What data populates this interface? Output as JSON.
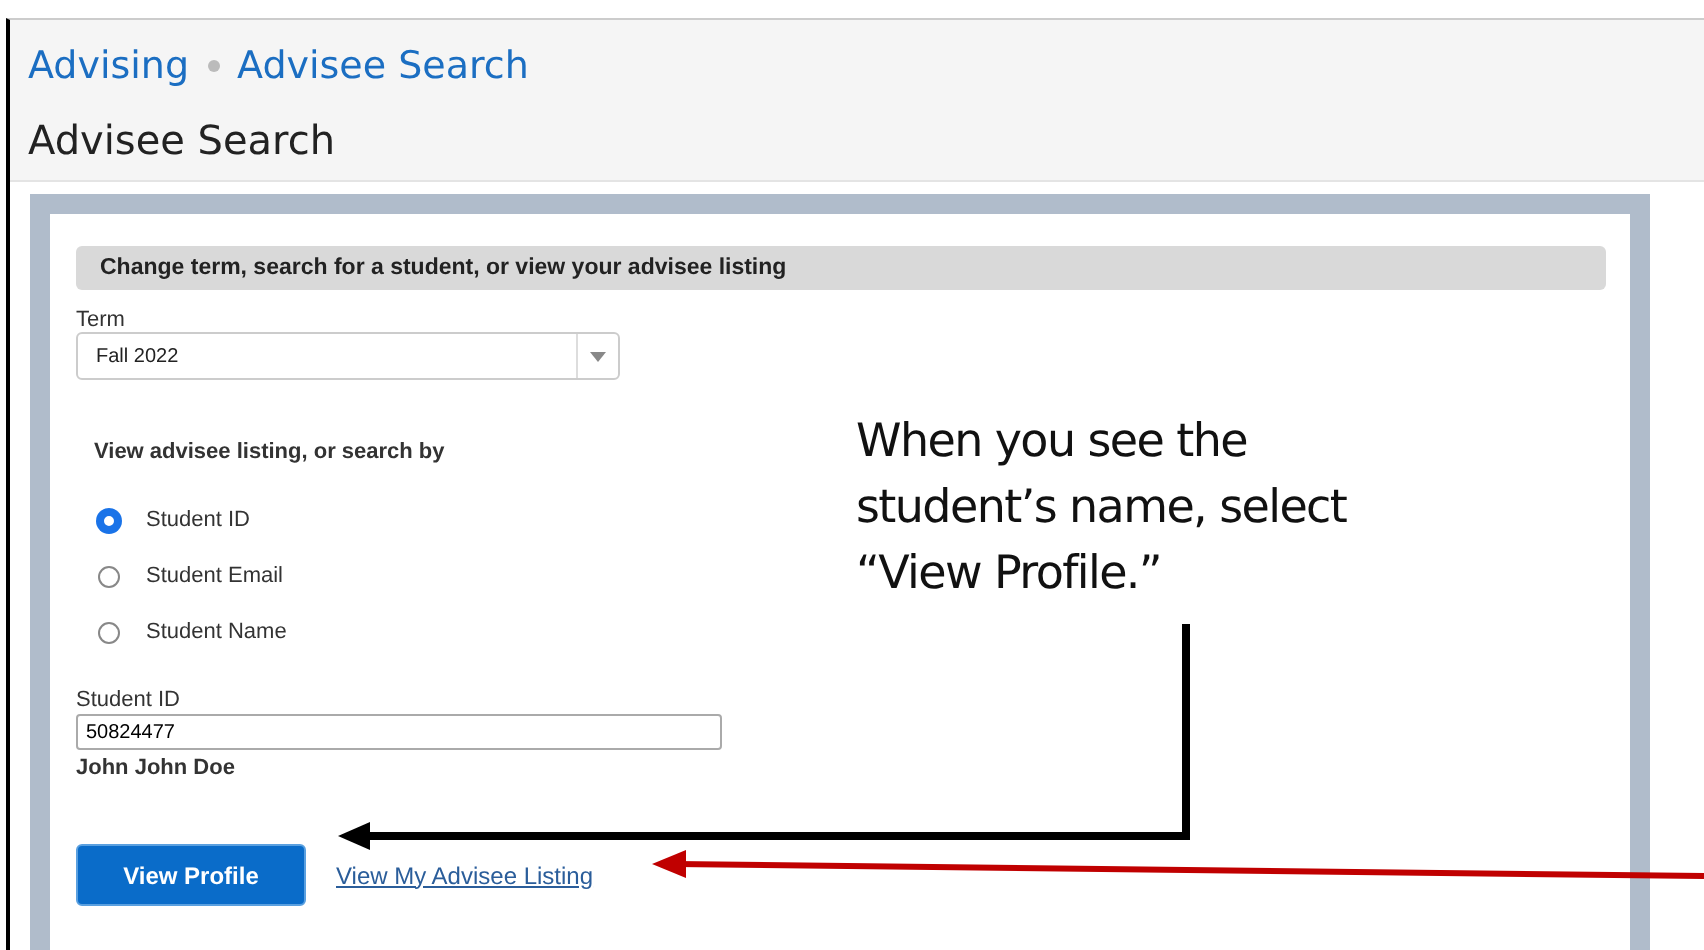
{
  "breadcrumb": [
    {
      "label": "Advising"
    },
    {
      "label": "Advisee Search"
    }
  ],
  "page_title": "Advisee Search",
  "panel": {
    "header": "Change term, search for a student, or view your advisee listing",
    "term": {
      "label": "Term",
      "value": "Fall 2022"
    },
    "search_by_label": "View advisee listing, or search by",
    "options": [
      {
        "label": "Student ID",
        "selected": true
      },
      {
        "label": "Student Email",
        "selected": false
      },
      {
        "label": "Student Name",
        "selected": false
      }
    ],
    "student_id": {
      "label": "Student ID",
      "value": "50824477"
    },
    "student_name": "John John Doe",
    "buttons": [
      {
        "label": "View Profile",
        "kind": "button"
      },
      {
        "label": "View My Advisee Listing",
        "kind": "link"
      }
    ]
  },
  "annotation": "When you see the student’s name, select “View Profile.”"
}
